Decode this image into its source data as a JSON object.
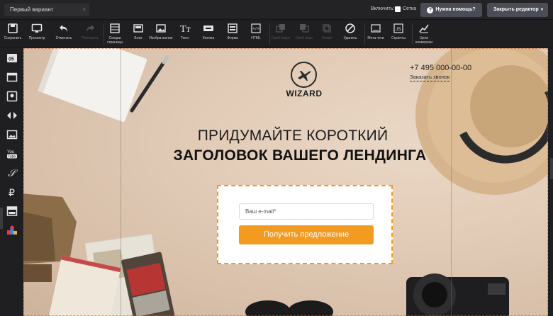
{
  "topbar": {
    "variant_name": "Первый вариант",
    "variant_close": "×",
    "enable_label": "Включить:",
    "grid_label": "Сетка",
    "help_button": "Нужна помощь?",
    "help_icon": "?",
    "close_editor": "Закрыть редактор",
    "close_caret": "▾"
  },
  "toolbar": {
    "items": [
      {
        "label": "Сохранить",
        "icon": "save-icon"
      },
      {
        "label": "Просмотр",
        "icon": "monitor-icon"
      },
      {
        "label": "Отменить",
        "icon": "undo-icon"
      },
      {
        "label": "Повторить",
        "icon": "redo-icon"
      },
      {
        "label": "Секции страницы",
        "icon": "sections-icon"
      },
      {
        "label": "Блок",
        "icon": "block-icon"
      },
      {
        "label": "Изобра-жение",
        "icon": "image-icon"
      },
      {
        "label": "Текст",
        "icon": "text-icon"
      },
      {
        "label": "Кнопка",
        "icon": "button-icon"
      },
      {
        "label": "Форма",
        "icon": "form-icon"
      },
      {
        "label": "HTML",
        "icon": "html-icon"
      },
      {
        "label": "Свой вверх",
        "icon": "layer-up-icon"
      },
      {
        "label": "Свой вниз",
        "icon": "layer-down-icon"
      },
      {
        "label": "Копия",
        "icon": "copy-icon"
      },
      {
        "label": "Удалить",
        "icon": "delete-icon"
      },
      {
        "label": "Мета-теги",
        "icon": "meta-icon"
      },
      {
        "label": "Скрипты",
        "icon": "scripts-icon"
      },
      {
        "label": "Цели конверсии",
        "icon": "chart-icon"
      }
    ]
  },
  "leftbar": {
    "items": [
      "timer-icon",
      "window-icon",
      "map-pin-icon",
      "code-arrows-icon",
      "gallery-icon",
      "youtube-icon",
      "signature-icon",
      "ruble-icon",
      "layout-icon",
      "share-icon"
    ],
    "timer_text": "05",
    "youtube_text": "You\nTube",
    "signature_text": "𝒮",
    "ruble_text": "₽"
  },
  "landing": {
    "logo_text": "WIZARD",
    "phone": "+7 495 000-00-00",
    "callback_link": "Заказать звонок",
    "headline_1": "ПРИДУМАЙТЕ КОРОТКИЙ",
    "headline_2": "ЗАГОЛОВОК ВАШЕГО ЛЕНДИНГА",
    "email_placeholder": "Ваш e-mail*",
    "submit_button": "Получить предложение"
  },
  "colors": {
    "accent": "#f39a21",
    "toolbar_bg": "#1f1f21",
    "button_bg": "#4a4d55"
  }
}
